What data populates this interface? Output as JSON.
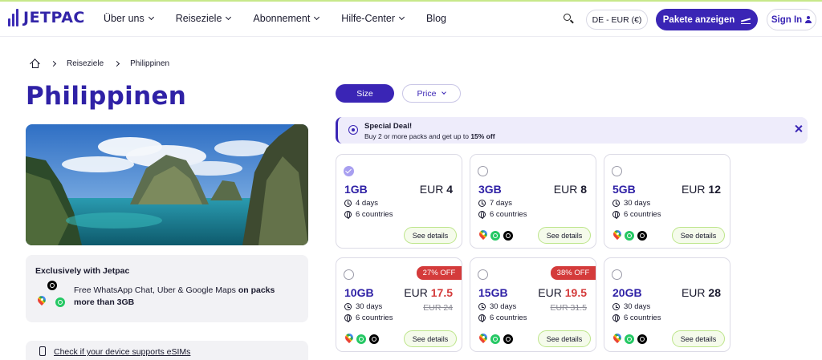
{
  "brand": {
    "name": "JETPAC",
    "accent": "#3a25b5",
    "lime": "#bde58a",
    "sale_red": "#d43b3b"
  },
  "nav": {
    "items": [
      {
        "label": "Über uns",
        "dropdown": true
      },
      {
        "label": "Reiseziele",
        "dropdown": true
      },
      {
        "label": "Abonnement",
        "dropdown": true
      },
      {
        "label": "Hilfe-Center",
        "dropdown": true
      },
      {
        "label": "Blog",
        "dropdown": false
      }
    ],
    "search_icon": "search-icon",
    "language": "DE - EUR (€)",
    "cta": "Pakete anzeigen",
    "signin": "Sign In"
  },
  "breadcrumb": {
    "home_icon": "home-icon",
    "items": [
      "Reiseziele",
      "Philippinen"
    ]
  },
  "page_title": "Philippinen",
  "exclusive": {
    "title": "Exclusively with Jetpac",
    "text": "Free WhatsApp Chat, Uber & Google Maps ",
    "text_bold": "on packs more than 3GB"
  },
  "device_check": "Check if your device supports eSIMs",
  "filters": {
    "size": "Size",
    "price": "Price",
    "active": "size"
  },
  "deal": {
    "title": "Special Deal!",
    "text": "Buy 2 or more packs and get up to ",
    "text_bold": "15% off"
  },
  "plans": [
    {
      "data": "1GB",
      "currency": "EUR",
      "price": "4",
      "old_price": "",
      "discount": "",
      "days": "4 days",
      "countries": "6 countries",
      "selected": true,
      "apps": [],
      "details": "See details"
    },
    {
      "data": "3GB",
      "currency": "EUR",
      "price": "8",
      "old_price": "",
      "discount": "",
      "days": "7 days",
      "countries": "6 countries",
      "selected": false,
      "apps": [
        "maps",
        "whatsapp",
        "uber"
      ],
      "details": "See details"
    },
    {
      "data": "5GB",
      "currency": "EUR",
      "price": "12",
      "old_price": "",
      "discount": "",
      "days": "30 days",
      "countries": "6 countries",
      "selected": false,
      "apps": [
        "maps",
        "whatsapp",
        "uber"
      ],
      "details": "See details"
    },
    {
      "data": "10GB",
      "currency": "EUR",
      "price": "17.5",
      "old_price": "EUR 24",
      "discount": "27% OFF",
      "days": "30 days",
      "countries": "6 countries",
      "selected": false,
      "apps": [
        "maps",
        "whatsapp",
        "uber"
      ],
      "details": "See details"
    },
    {
      "data": "15GB",
      "currency": "EUR",
      "price": "19.5",
      "old_price": "EUR 31.5",
      "discount": "38% OFF",
      "days": "30 days",
      "countries": "6 countries",
      "selected": false,
      "apps": [
        "maps",
        "whatsapp",
        "uber"
      ],
      "details": "See details"
    },
    {
      "data": "20GB",
      "currency": "EUR",
      "price": "28",
      "old_price": "",
      "discount": "",
      "days": "30 days",
      "countries": "6 countries",
      "selected": false,
      "apps": [
        "maps",
        "whatsapp",
        "uber"
      ],
      "details": "See details"
    }
  ]
}
